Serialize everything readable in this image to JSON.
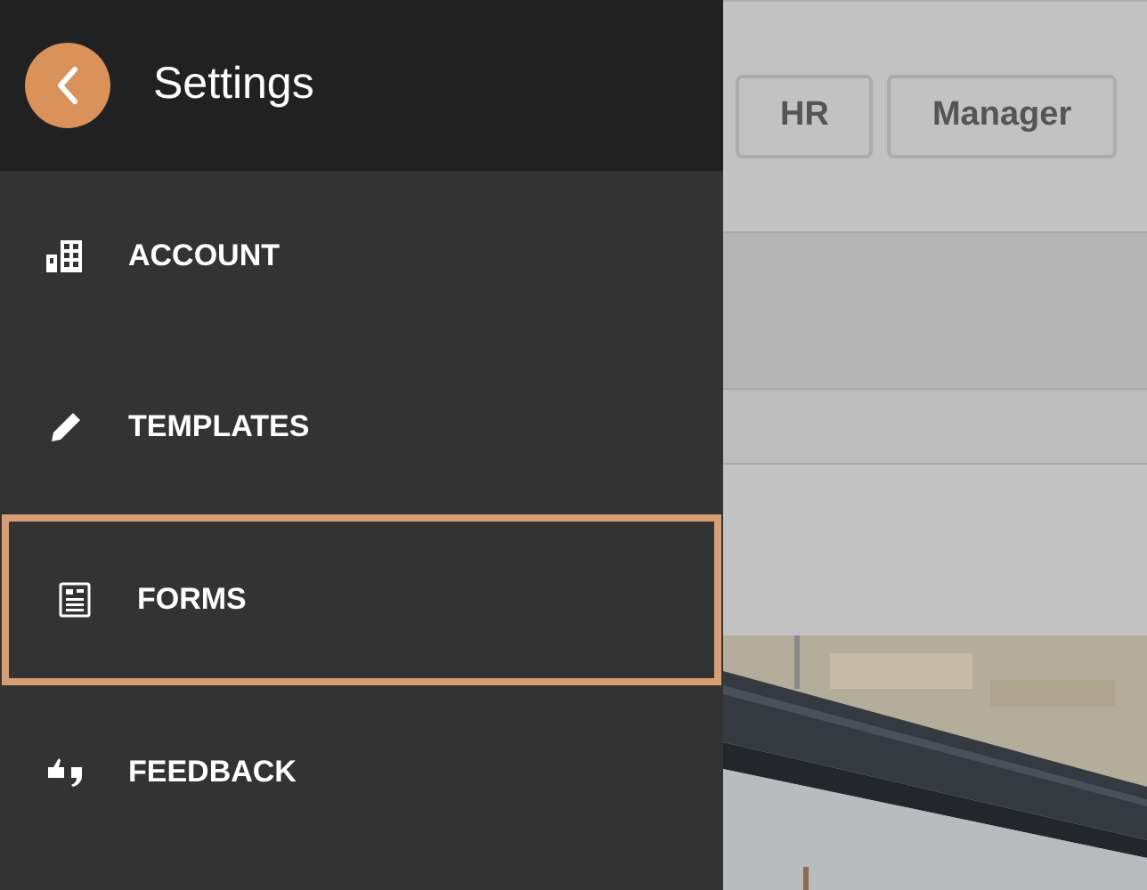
{
  "sidebar": {
    "title": "Settings",
    "items": [
      {
        "kind": "account",
        "label": "ACCOUNT",
        "selected": false
      },
      {
        "kind": "templates",
        "label": "TEMPLATES",
        "selected": false
      },
      {
        "kind": "forms",
        "label": "FORMS",
        "selected": true
      },
      {
        "kind": "feedback",
        "label": "FEEDBACK",
        "selected": false
      }
    ]
  },
  "background": {
    "buttons": [
      "HR",
      "Manager"
    ]
  }
}
